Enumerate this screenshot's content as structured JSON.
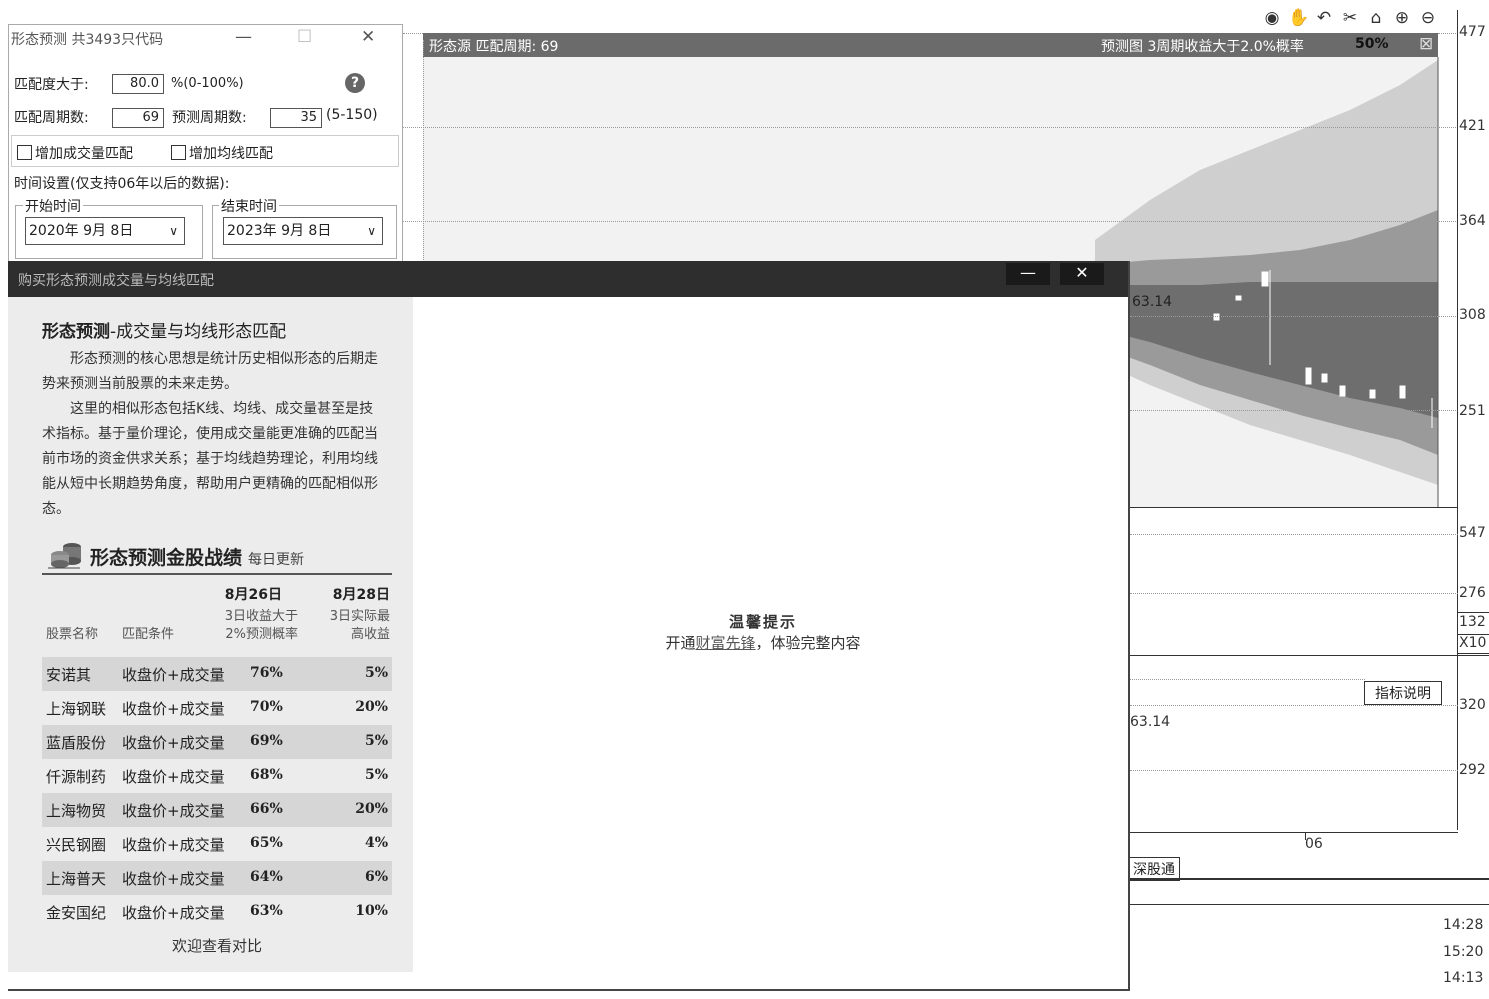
{
  "chart": {
    "header_left": "形态源 匹配周期: 69",
    "header_right": "预测图 3周期收益大于2.0%概率",
    "header_pct": "50%",
    "close_glyph": "⊠",
    "toolbar_icons": [
      "eye-icon",
      "hand-icon",
      "undo-icon",
      "scissors-icon",
      "lock-icon",
      "zoom-in-icon",
      "zoom-out-icon"
    ],
    "toolbar_glyphs": [
      "◉",
      "✋",
      "↶",
      "✂",
      "⌂",
      "⊕",
      "⊖"
    ],
    "price_labels": [
      "477",
      "421",
      "364",
      "308",
      "251"
    ],
    "volume_labels": [
      "547",
      "276",
      "132",
      "X10"
    ],
    "indicator_labels": [
      "320",
      "292"
    ],
    "price_marker": "63.14",
    "price_marker_2": "63.14",
    "indicator_button": "指标说明",
    "axis_label_06": "06",
    "tab_label": "深股通",
    "times": [
      "14:28",
      "15:20",
      "14:13"
    ]
  },
  "form": {
    "title": "形态预测 共3493只代码",
    "min_glyph": "—",
    "max_glyph": "☐",
    "close_glyph": "✕",
    "match_label": "匹配度大于:",
    "match_value": "80.0",
    "match_unit": "%(0-100%)",
    "help_glyph": "?",
    "period_label": "匹配周期数:",
    "period_value": "69",
    "predict_label": "预测周期数:",
    "predict_value": "35",
    "predict_range": "(5-150)",
    "chk_volume": "增加成交量匹配",
    "chk_ma": "增加均线匹配",
    "time_setting": "时间设置(仅支持06年以后的数据):",
    "start_label": "开始时间",
    "start_value": "2020年 9月 8日",
    "end_label": "结束时间",
    "end_value": "2023年 9月 8日",
    "dropdown_glyph": "∨"
  },
  "buy": {
    "title": "购买形态预测成交量与均线匹配",
    "min_glyph": "—",
    "close_glyph": "✕",
    "heading_bold": "形态预测",
    "heading_rest": "-成交量与均线形态匹配",
    "para1": "　　形态预测的核心思想是统计历史相似形态的后期走势来预测当前股票的未来走势。",
    "para2": "　　这里的相似形态包括K线、均线、成交量甚至是技术指标。基于量价理论，使用成交量能更准确的匹配当前市场的资金供求关系；基于均线趋势理论，利用均线能从短中长期趋势角度，帮助用户更精确的匹配相似形态。",
    "section_title": "形态预测金股战绩",
    "section_sub": "每日更新",
    "col_date1": "8月26日",
    "col_date2": "8月28日",
    "col_sub1a": "3日收益大于",
    "col_sub1b": "2%预测概率",
    "col_sub2a": "3日实际最",
    "col_sub2b": "高收益",
    "col_name": "股票名称",
    "col_cond": "匹配条件",
    "rows": [
      {
        "name": "安诺其",
        "cond": "收盘价+成交量",
        "prob": "76%",
        "gain": "5%"
      },
      {
        "name": "上海钢联",
        "cond": "收盘价+成交量",
        "prob": "70%",
        "gain": "20%"
      },
      {
        "name": "蓝盾股份",
        "cond": "收盘价+成交量",
        "prob": "69%",
        "gain": "5%"
      },
      {
        "name": "仟源制药",
        "cond": "收盘价+成交量",
        "prob": "68%",
        "gain": "5%"
      },
      {
        "name": "上海物贸",
        "cond": "收盘价+成交量",
        "prob": "66%",
        "gain": "20%"
      },
      {
        "name": "兴民钢圈",
        "cond": "收盘价+成交量",
        "prob": "65%",
        "gain": "4%"
      },
      {
        "name": "上海普天",
        "cond": "收盘价+成交量",
        "prob": "64%",
        "gain": "6%"
      },
      {
        "name": "金安国纪",
        "cond": "收盘价+成交量",
        "prob": "63%",
        "gain": "10%"
      }
    ],
    "footer": "欢迎查看对比",
    "tip_title": "温馨提示",
    "tip_pre": "开通",
    "tip_link": "财富先锋",
    "tip_post": "，体验完整内容"
  }
}
